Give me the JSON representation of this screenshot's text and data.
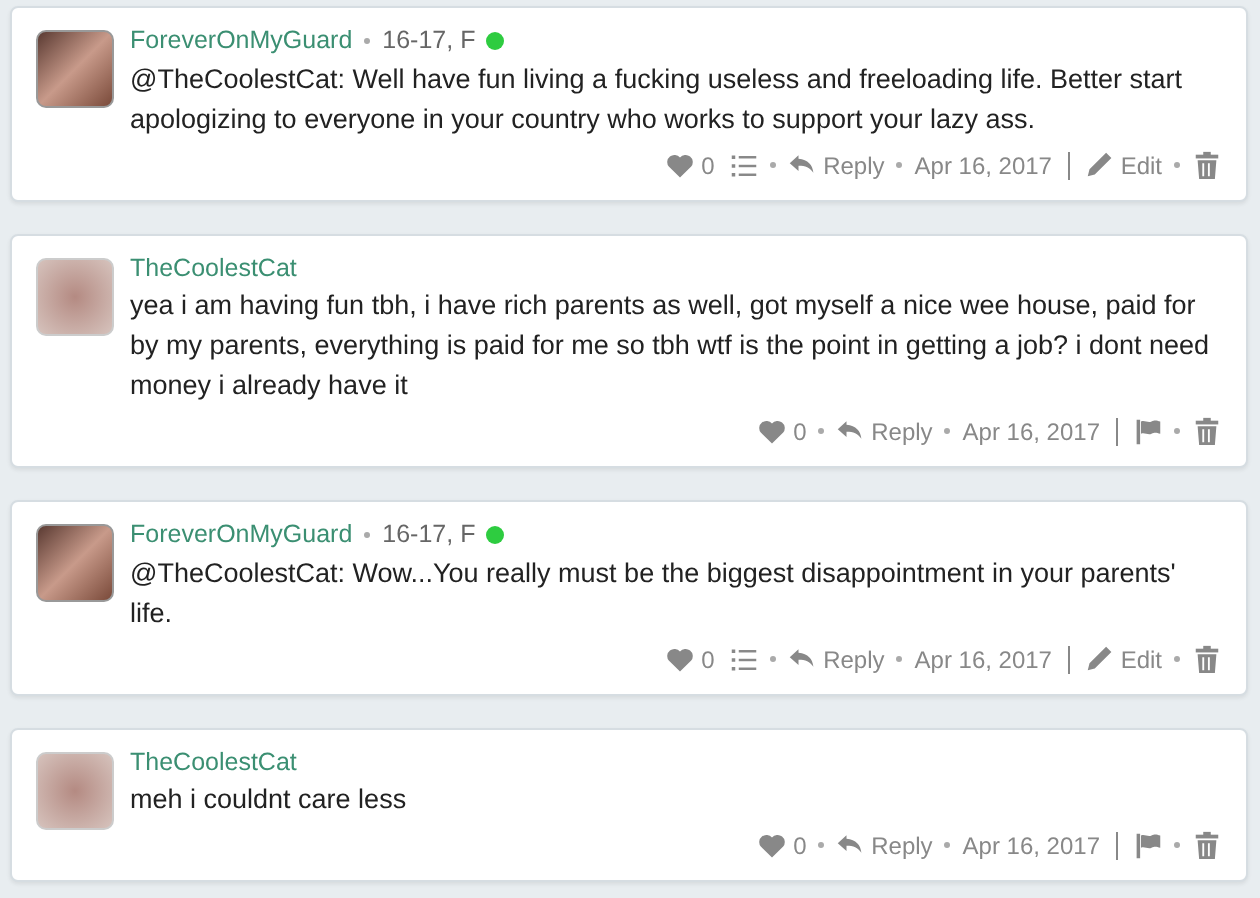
{
  "comments": [
    {
      "kind": "own",
      "author": "ForeverOnMyGuard",
      "meta": "16-17, F",
      "online": true,
      "text": "@TheCoolestCat: Well have fun living a fucking useless and freeloading life. Better start apologizing to everyone in your country who works to support your lazy ass.",
      "likes": "0",
      "reply": "Reply",
      "date": "Apr 16, 2017",
      "edit": "Edit"
    },
    {
      "kind": "other",
      "author": "TheCoolestCat",
      "text": "yea i am having fun tbh, i have rich parents as well, got myself a nice wee house, paid for by my parents, everything is paid for me so tbh wtf is the point in getting a job? i dont need money i already have it",
      "likes": "0",
      "reply": "Reply",
      "date": "Apr 16, 2017"
    },
    {
      "kind": "own",
      "author": "ForeverOnMyGuard",
      "meta": "16-17, F",
      "online": true,
      "text": "@TheCoolestCat: Wow...You really must be the biggest disappointment in your parents' life.",
      "likes": "0",
      "reply": "Reply",
      "date": "Apr 16, 2017",
      "edit": "Edit"
    },
    {
      "kind": "other",
      "author": "TheCoolestCat",
      "text": "meh i couldnt care less",
      "likes": "0",
      "reply": "Reply",
      "date": "Apr 16, 2017"
    }
  ]
}
